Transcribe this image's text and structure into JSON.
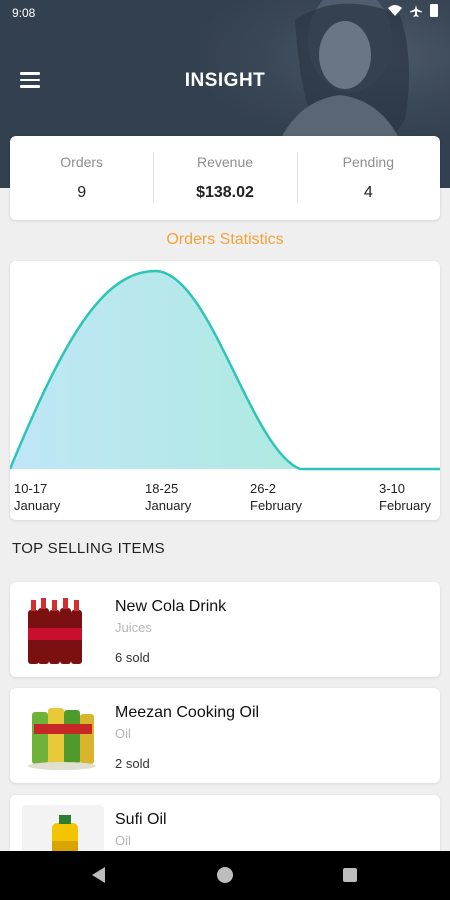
{
  "status_bar": {
    "time": "9:08"
  },
  "header": {
    "title": "INSIGHT"
  },
  "stats": [
    {
      "label": "Orders",
      "value": "9"
    },
    {
      "label": "Revenue",
      "value": "$138.02"
    },
    {
      "label": "Pending",
      "value": "4"
    }
  ],
  "chart_section": {
    "title": "Orders Statistics"
  },
  "chart_data": {
    "type": "area",
    "categories": [
      "10-17 January",
      "18-25 January",
      "26-2 February",
      "3-10 February"
    ],
    "tick_labels": [
      {
        "top": "10-17",
        "bottom": "January"
      },
      {
        "top": "18-25",
        "bottom": "January"
      },
      {
        "top": "26-2",
        "bottom": "February"
      },
      {
        "top": "3-10",
        "bottom": "February"
      }
    ],
    "values": [
      0,
      8,
      0,
      0
    ],
    "ylim": [
      0,
      8
    ],
    "grid": false,
    "colors": {
      "line": "#2ec4b6",
      "fill_start": "#bfe6f7",
      "fill_end": "#a6ecd6"
    }
  },
  "top_selling": {
    "heading": "TOP SELLING ITEMS",
    "items": [
      {
        "name": "New Cola Drink",
        "category": "Juices",
        "sold": "6 sold",
        "icon": "cola-bottles-image"
      },
      {
        "name": "Meezan Cooking Oil",
        "category": "Oil",
        "sold": "2 sold",
        "icon": "cooking-oil-bottles-image"
      },
      {
        "name": "Sufi Oil",
        "category": "Oil",
        "sold": "",
        "icon": "oil-bottle-image"
      }
    ]
  }
}
